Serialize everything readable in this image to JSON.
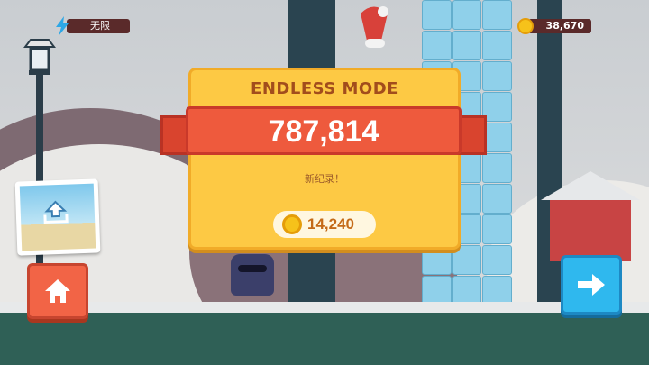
{
  "hud": {
    "energy_label": "无限",
    "coins": "38,670"
  },
  "result_panel": {
    "title": "ENDLESS MODE",
    "score": "787,814",
    "new_record": "新纪录！",
    "reward_coins": "14,240"
  },
  "icons": {
    "energy": "lightning-bolt-icon",
    "coin": "coin-icon",
    "home": "home-icon",
    "next": "arrow-right-icon",
    "share": "upload-icon"
  },
  "colors": {
    "panel": "#fdc944",
    "ribbon": "#ee5a3d",
    "home_button": "#f26446",
    "next_button": "#2fb8ee",
    "title_text": "#a24d1c"
  }
}
